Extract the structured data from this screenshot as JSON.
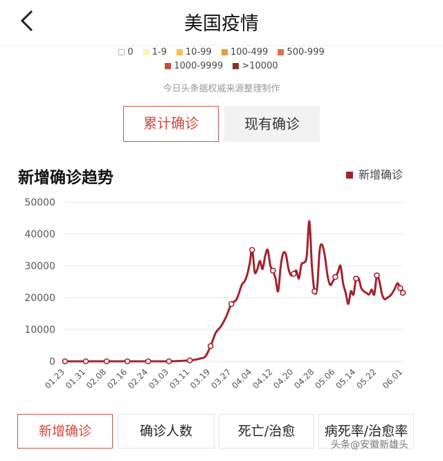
{
  "header": {
    "title": "美国疫情"
  },
  "legend": {
    "items": [
      {
        "label": "0",
        "color": "#ffffff",
        "border": "#bbbbbb"
      },
      {
        "label": "1-9",
        "color": "#fff3b0"
      },
      {
        "label": "10-99",
        "color": "#f8c04a"
      },
      {
        "label": "100-499",
        "color": "#ee9a3c"
      },
      {
        "label": "500-999",
        "color": "#e2704e"
      },
      {
        "label": "1000-9999",
        "color": "#c94c35"
      },
      {
        "label": ">10000",
        "color": "#8a3323"
      }
    ]
  },
  "source_note": "今日头条据权威来源整理制作",
  "tabs": {
    "cumulative": "累计确诊",
    "current": "现有确诊"
  },
  "chart_section": {
    "title": "新增确诊趋势",
    "series_label": "新增确诊",
    "series_color": "#a3222c"
  },
  "chart_data": {
    "type": "line",
    "title": "新增确诊趋势",
    "xlabel": "",
    "ylabel": "",
    "ylim": [
      0,
      50000
    ],
    "yticks": [
      0,
      10000,
      20000,
      30000,
      40000,
      50000
    ],
    "x_ticks": [
      "01.23",
      "01.31",
      "02.08",
      "02.16",
      "02.24",
      "03.03",
      "03.11",
      "03.19",
      "03.27",
      "04.04",
      "04.12",
      "04.20",
      "04.28",
      "05.06",
      "05.14",
      "05.22",
      "06.01"
    ],
    "grid": true,
    "series": [
      {
        "name": "新增确诊",
        "x": [
          "01.23",
          "01.31",
          "02.08",
          "02.16",
          "02.24",
          "03.03",
          "03.07",
          "03.11",
          "03.13",
          "03.15",
          "03.17",
          "03.19",
          "03.21",
          "03.23",
          "03.25",
          "03.27",
          "03.29",
          "03.31",
          "04.01",
          "04.02",
          "04.03",
          "04.04",
          "04.05",
          "04.06",
          "04.07",
          "04.08",
          "04.09",
          "04.10",
          "04.11",
          "04.12",
          "04.13",
          "04.14",
          "04.15",
          "04.16",
          "04.17",
          "04.18",
          "04.19",
          "04.20",
          "04.21",
          "04.22",
          "04.23",
          "04.24",
          "04.25",
          "04.26",
          "04.27",
          "04.28",
          "04.29",
          "04.30",
          "05.01",
          "05.02",
          "05.03",
          "05.04",
          "05.05",
          "05.06",
          "05.07",
          "05.08",
          "05.09",
          "05.10",
          "05.11",
          "05.12",
          "05.13",
          "05.14",
          "05.15",
          "05.16",
          "05.17",
          "05.18",
          "05.19",
          "05.20",
          "05.21",
          "05.22",
          "05.23",
          "05.24",
          "05.25",
          "05.26",
          "05.27",
          "05.28",
          "05.29",
          "05.30",
          "05.31",
          "06.01"
        ],
        "values": [
          0,
          0,
          0,
          0,
          0,
          0,
          100,
          300,
          500,
          900,
          1500,
          4800,
          9000,
          11000,
          14000,
          18000,
          19500,
          24000,
          25000,
          27000,
          30500,
          35000,
          28000,
          29000,
          31500,
          29000,
          33000,
          35000,
          30000,
          28500,
          26000,
          22000,
          30000,
          34000,
          33500,
          29000,
          27000,
          27500,
          28500,
          26000,
          30500,
          31000,
          33000,
          44000,
          30000,
          22000,
          23000,
          35000,
          36500,
          33000,
          27000,
          24000,
          25000,
          26500,
          28000,
          30000,
          24500,
          21500,
          18000,
          22000,
          21000,
          26000,
          26000,
          23000,
          22000,
          21500,
          21000,
          22500,
          21000,
          27000,
          25000,
          21000,
          19500,
          20000,
          20500,
          21500,
          23000,
          24500,
          23000,
          21500
        ],
        "markers": [
          "01.23",
          "01.31",
          "02.08",
          "02.16",
          "02.24",
          "03.03",
          "03.11",
          "03.19",
          "03.27",
          "04.04",
          "04.12",
          "04.20",
          "04.28",
          "05.06",
          "05.14",
          "05.22",
          "05.31",
          "06.01"
        ]
      }
    ]
  },
  "bottom_tabs": {
    "new": "新增确诊",
    "total": "确诊人数",
    "death_cure": "死亡/治愈",
    "rates": "病死率/治愈率"
  },
  "watermark": "头条@安徽新雄头"
}
